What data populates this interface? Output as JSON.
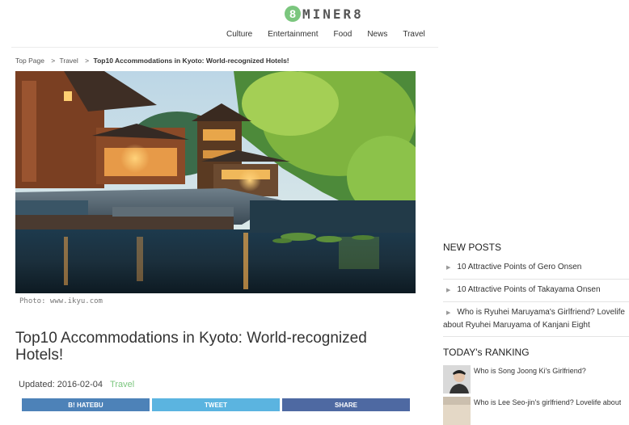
{
  "logo": {
    "badge": "8",
    "text": "MINER8"
  },
  "nav": [
    "Culture",
    "Entertainment",
    "Food",
    "News",
    "Travel"
  ],
  "breadcrumb": {
    "items": [
      "Top Page",
      "Travel"
    ],
    "separator": ">",
    "current": "Top10 Accommodations in Kyoto: World-recognized Hotels!"
  },
  "hero": {
    "caption": "Photo: www.ikyu.com"
  },
  "article": {
    "title": "Top10 Accommodations in Kyoto: World-recognized Hotels!",
    "updated": "Updated: 2016-02-04",
    "category": "Travel"
  },
  "share": {
    "hatebu": "B! HATEBU",
    "tweet": "TWEET",
    "share": "SHARE"
  },
  "sidebar": {
    "new_posts_title": "NEW POSTS",
    "new_posts": [
      "10 Attractive Points of Gero Onsen",
      "10 Attractive Points of Takayama Onsen",
      "Who is Ryuhei Maruyama's Girlfriend? Lovelife about Ryuhei Maruyama of Kanjani Eight"
    ],
    "ranking_title": "TODAY's RANKING",
    "ranking": [
      "Who is Song Joong Ki's Girlfriend?",
      "Who is Lee Seo-jin's girlfriend? Lovelife about"
    ]
  },
  "colors": {
    "accent_green": "#7bc67e",
    "hatebu": "#4d82b8",
    "tweet": "#5bb4e0",
    "share": "#4e69a2"
  }
}
